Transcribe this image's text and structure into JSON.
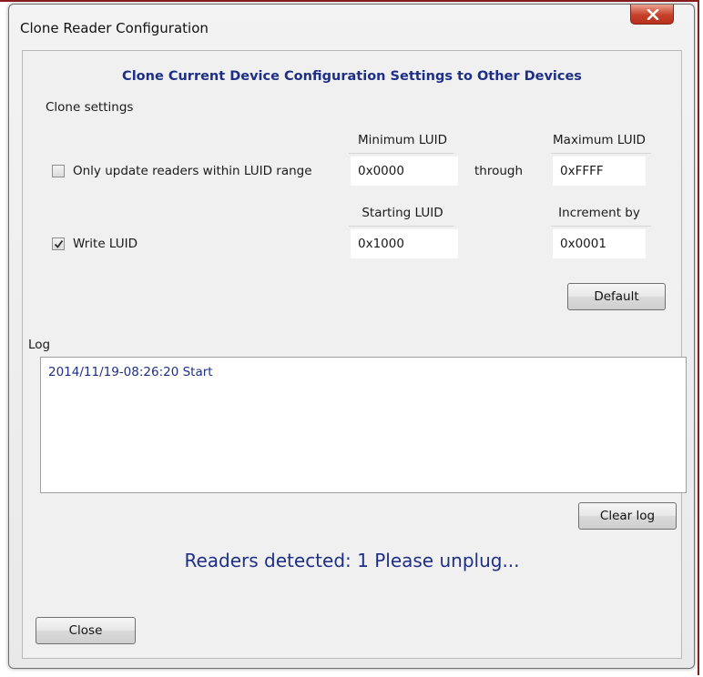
{
  "window": {
    "title": "Clone Reader Configuration"
  },
  "header": {
    "heading": "Clone Current Device Configuration Settings to Other Devices",
    "section_label": "Clone settings"
  },
  "luid_range": {
    "checkbox_label": "Only update readers within LUID range",
    "checked": false,
    "min_header": "Minimum LUID",
    "min_value": "0x0000",
    "through_label": "through",
    "max_header": "Maximum LUID",
    "max_value": "0xFFFF"
  },
  "write_luid": {
    "checkbox_label": "Write LUID",
    "checked": true,
    "start_header": "Starting LUID",
    "start_value": "0x1000",
    "increment_header": "Increment by",
    "increment_value": "0x0001"
  },
  "buttons": {
    "default_label": "Default",
    "clear_log_label": "Clear log",
    "close_label": "Close"
  },
  "log": {
    "label": "Log",
    "entries": [
      "2014/11/19-08:26:20 Start"
    ]
  },
  "status": {
    "text": "Readers detected: 1 Please unplug..."
  },
  "icons": {
    "close": "close-icon",
    "check": "checkmark-icon"
  },
  "colors": {
    "accent_text": "#1e2f86",
    "close_button": "#c7402a",
    "frame": "#8a1c1c"
  }
}
